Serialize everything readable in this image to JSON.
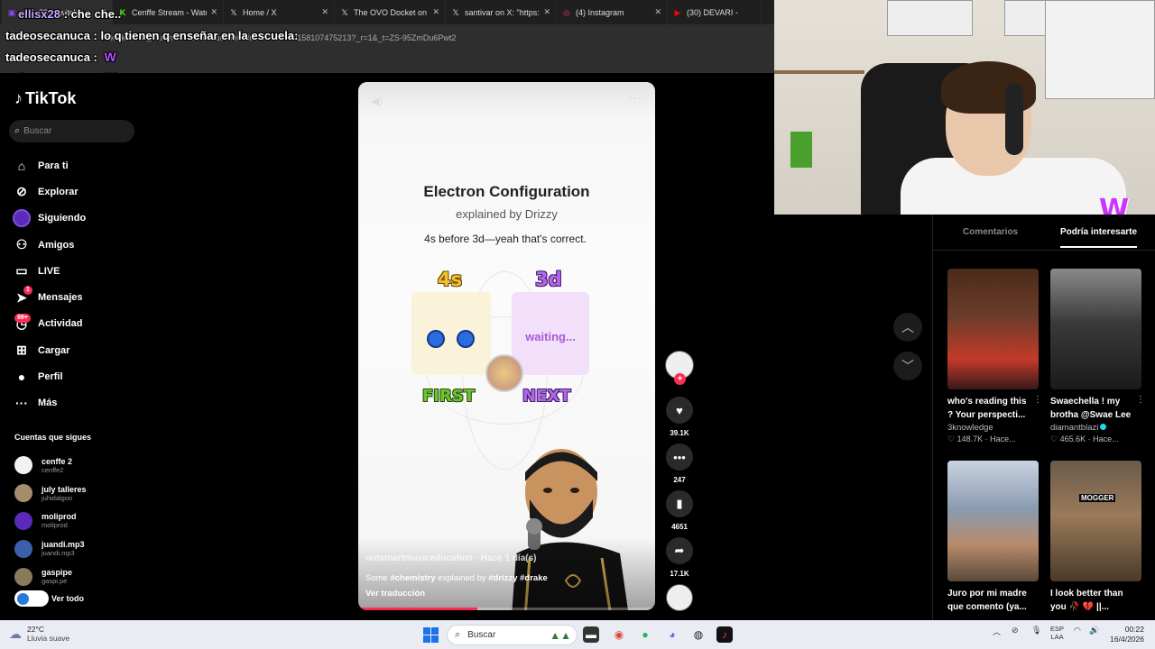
{
  "browser": {
    "tabs": [
      {
        "label": "ellisx28 - Twitch",
        "icon": "twitch-icon",
        "color": "#9146ff"
      },
      {
        "label": "Cenffe Stream - Watc",
        "icon": "kick-icon",
        "color": "#53fc18"
      },
      {
        "label": "Home / X",
        "icon": "x-icon",
        "color": "#ffffff"
      },
      {
        "label": "The OVO Docket on",
        "icon": "x-icon",
        "color": "#ffffff"
      },
      {
        "label": "santivar on X: \"https:",
        "icon": "x-icon",
        "color": "#ffffff"
      },
      {
        "label": "(4) Instagram",
        "icon": "instagram-icon",
        "color": "#e1306c"
      },
      {
        "label": "(30) DEVARI - ",
        "icon": "youtube-icon",
        "color": "#ff0000"
      }
    ],
    "url": "tiktok.com/@outsmartmusiceducation/video/7628759158107475213?_r=1&_t=ZS-95ZmDu6Pwt2"
  },
  "chat": [
    {
      "user": "ellisx28",
      "text": "che che..",
      "emote": ""
    },
    {
      "user": "tadeosecanuca",
      "text": "lo q tienen q enseñar en la escuela:",
      "emote": ""
    },
    {
      "user": "tadeosecanuca",
      "text": "",
      "emote": "W"
    },
    {
      "user": "tadeosecanuca",
      "text": "",
      "emote": "W"
    }
  ],
  "tiktok": {
    "logo": "TikTok",
    "search_placeholder": "Buscar",
    "nav": [
      {
        "label": "Para ti",
        "icon": "home-icon"
      },
      {
        "label": "Explorar",
        "icon": "compass-icon"
      },
      {
        "label": "Siguiendo",
        "icon": "following-avatar-icon"
      },
      {
        "label": "Amigos",
        "icon": "friends-icon"
      },
      {
        "label": "LIVE",
        "icon": "live-icon"
      },
      {
        "label": "Mensajes",
        "icon": "messages-icon",
        "badge": "1"
      },
      {
        "label": "Actividad",
        "icon": "activity-icon",
        "badge": "99+"
      },
      {
        "label": "Cargar",
        "icon": "upload-icon"
      },
      {
        "label": "Perfil",
        "icon": "profile-icon"
      },
      {
        "label": "Más",
        "icon": "more-icon"
      }
    ],
    "following_title": "Cuentas que sigues",
    "following": [
      {
        "name": "cenffe 2",
        "handle": "cenffe2"
      },
      {
        "name": "july talleres",
        "handle": "juhidalgoo"
      },
      {
        "name": "moliprod",
        "handle": "moliprod"
      },
      {
        "name": "juandi.mp3",
        "handle": "juandi.mp3"
      },
      {
        "name": "gaspipe",
        "handle": "gaspi.pe"
      }
    ],
    "see_all": "Ver todo"
  },
  "video": {
    "title": "Electron Configuration",
    "subtitle": "explained by Drizzy",
    "line": "4s before 3d—yeah that's correct.",
    "orbital_left": "4s",
    "orbital_right": "3d",
    "waiting": "waiting...",
    "first": "FIRST",
    "next": "NEXT",
    "author": "outsmartmusiceducation · Hace 1 día(s)",
    "description_prefix": "Some ",
    "tag1": "#chemistry",
    "description_mid": " explained by ",
    "tag2": "#drizzy",
    "tag3": "#drake",
    "translate": "Ver traducción",
    "progress": 0.4
  },
  "actions": {
    "likes": "39.1K",
    "comments": "247",
    "saves": "4651",
    "shares": "17.1K"
  },
  "right_panel": {
    "tab_comments": "Comentarios",
    "tab_related": "Podría interesarte",
    "cards": [
      {
        "title": "who's reading this",
        "title2": "? Your perspecti...",
        "author": "3knowledge",
        "likes": "148.7K",
        "time": "Hace...",
        "verified": false
      },
      {
        "title": "Swaechella ! my",
        "title2": "brotha @Swae Lee",
        "author": "diamantblazi",
        "likes": "465.6K",
        "time": "Hace...",
        "verified": true
      },
      {
        "title": "Juro por mi madre",
        "title2": "que comento (ya...",
        "author": "",
        "likes": "",
        "time": "",
        "verified": false,
        "overlay": ""
      },
      {
        "title": "I look better than",
        "title2": "you 🥀 💔 ||...",
        "author": "",
        "likes": "",
        "time": "",
        "verified": false,
        "overlay": "MOGGER"
      }
    ]
  },
  "webcam": {
    "overlay_logo": "W"
  },
  "taskbar": {
    "weather_temp": "22°C",
    "weather_desc": "Lluvia suave",
    "search": "Buscar",
    "lang1": "ESP",
    "lang2": "LAA",
    "time": "00:22",
    "date": "16/4/2026"
  }
}
